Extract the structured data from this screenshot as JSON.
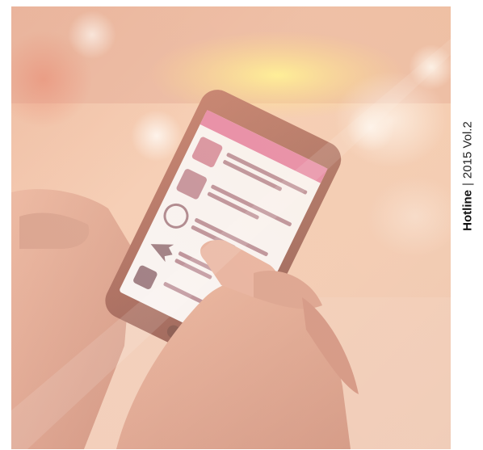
{
  "magazine": {
    "brand": "Hotline",
    "separator": "|",
    "issue": "2015 Vol.2"
  },
  "photo": {
    "description_icons": [
      "luggage-icon",
      "liquids-icon",
      "no-smoking-icon",
      "airplane-icon",
      "wheelchair-icon"
    ],
    "accent_color": "#e06d93",
    "tint_color": "#f4b59a"
  }
}
